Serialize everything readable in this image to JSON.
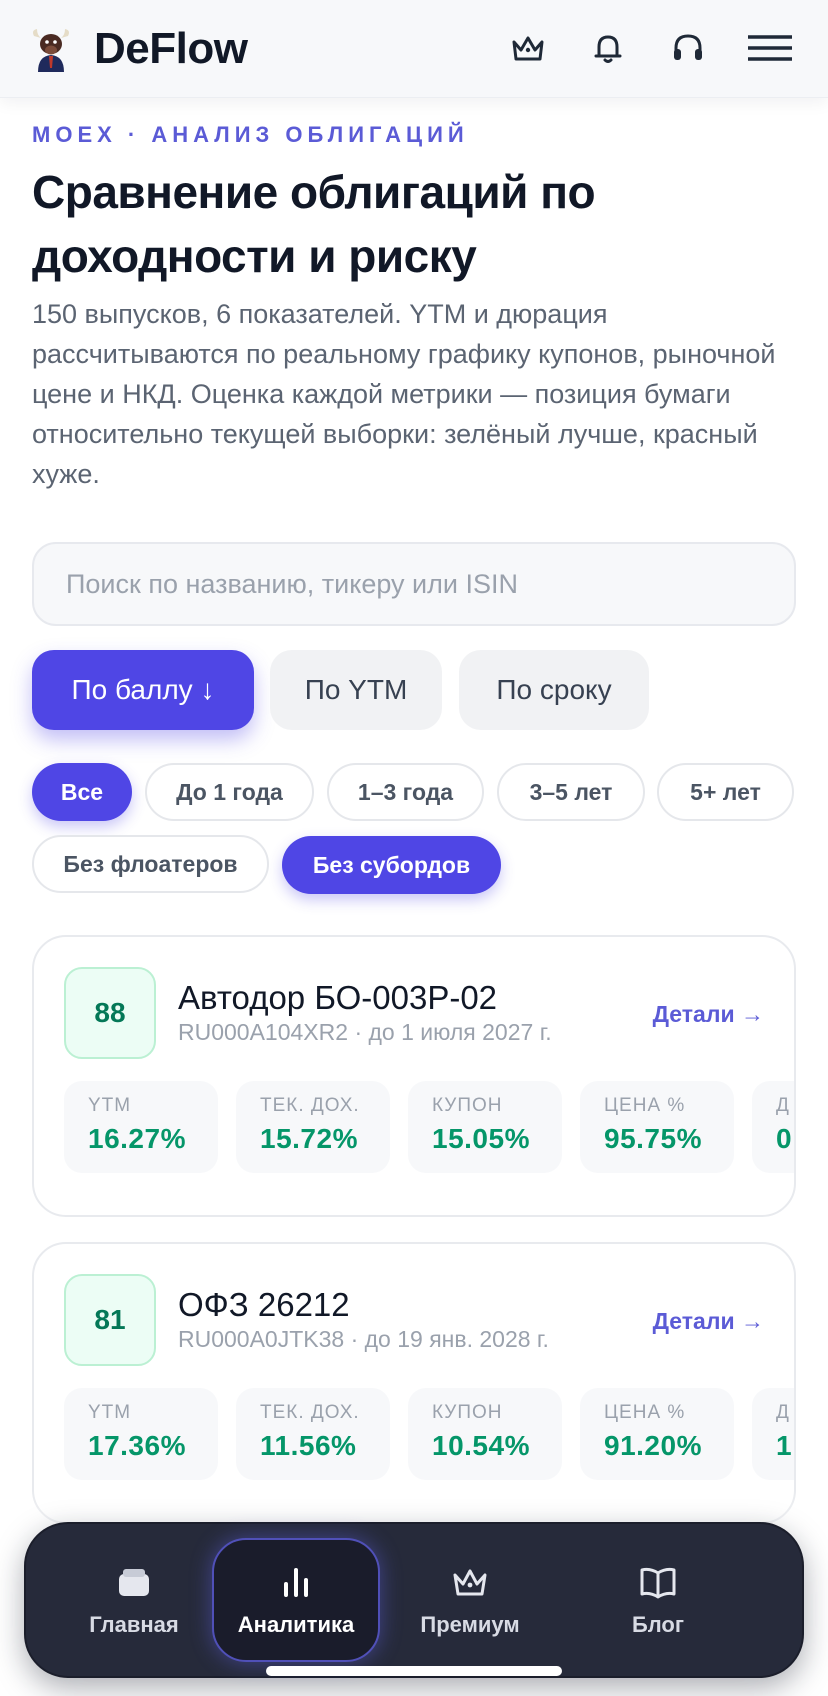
{
  "header": {
    "brand": "DeFlow",
    "icons": [
      "crown-icon",
      "bell-icon",
      "headset-icon",
      "menu-icon"
    ]
  },
  "page": {
    "eyebrow": "MOEX · АНАЛИЗ ОБЛИГАЦИЙ",
    "title": "Сравнение облигаций по доходности и риску",
    "description": "150 выпусков, 6 показателей. YTM и дюрация рассчитываются по реальному графику купонов, рыночной цене и НКД. Оценка каждой метрики — позиция бумаги относительно текущей выборки: зелёный лучше, красный хуже."
  },
  "search": {
    "placeholder": "Поиск по названию, тикеру или ISIN",
    "value": ""
  },
  "sort": {
    "by_score": "По баллу ↓",
    "by_ytm": "По YTM",
    "by_term": "По сроку",
    "active": "by_score"
  },
  "filters": {
    "all": "Все",
    "upto1": "До 1 года",
    "y1_3": "1–3 года",
    "y3_5": "3–5 лет",
    "y5plus": "5+ лет",
    "no_floaters": "Без флоатеров",
    "no_subords": "Без субордов",
    "active": [
      "all",
      "no_subords"
    ]
  },
  "bonds": [
    {
      "score": "88",
      "name": "Автодор БО-003Р-02",
      "meta": "RU000A104XR2 · до 1 июля 2027 г.",
      "details": "Детали →",
      "metrics": [
        {
          "label": "YTM",
          "value": "16.27%"
        },
        {
          "label": "ТЕК. ДОХ.",
          "value": "15.72%"
        },
        {
          "label": "КУПОН",
          "value": "15.05%"
        },
        {
          "label": "ЦЕНА %",
          "value": "95.75%"
        },
        {
          "label": "Д",
          "value": "0"
        }
      ]
    },
    {
      "score": "81",
      "name": "ОФЗ 26212",
      "meta": "RU000A0JTK38 · до 19 янв. 2028 г.",
      "details": "Детали →",
      "metrics": [
        {
          "label": "YTM",
          "value": "17.36%"
        },
        {
          "label": "ТЕК. ДОХ.",
          "value": "11.56%"
        },
        {
          "label": "КУПОН",
          "value": "10.54%"
        },
        {
          "label": "ЦЕНА %",
          "value": "91.20%"
        },
        {
          "label": "Д",
          "value": "1"
        }
      ]
    }
  ],
  "nav": {
    "home": "Главная",
    "analytics": "Аналитика",
    "premium": "Премиум",
    "blog": "Блог",
    "active": "analytics"
  },
  "colors": {
    "accent": "#4f46e5",
    "positive": "#059669",
    "nav_bg": "#262a3a"
  }
}
